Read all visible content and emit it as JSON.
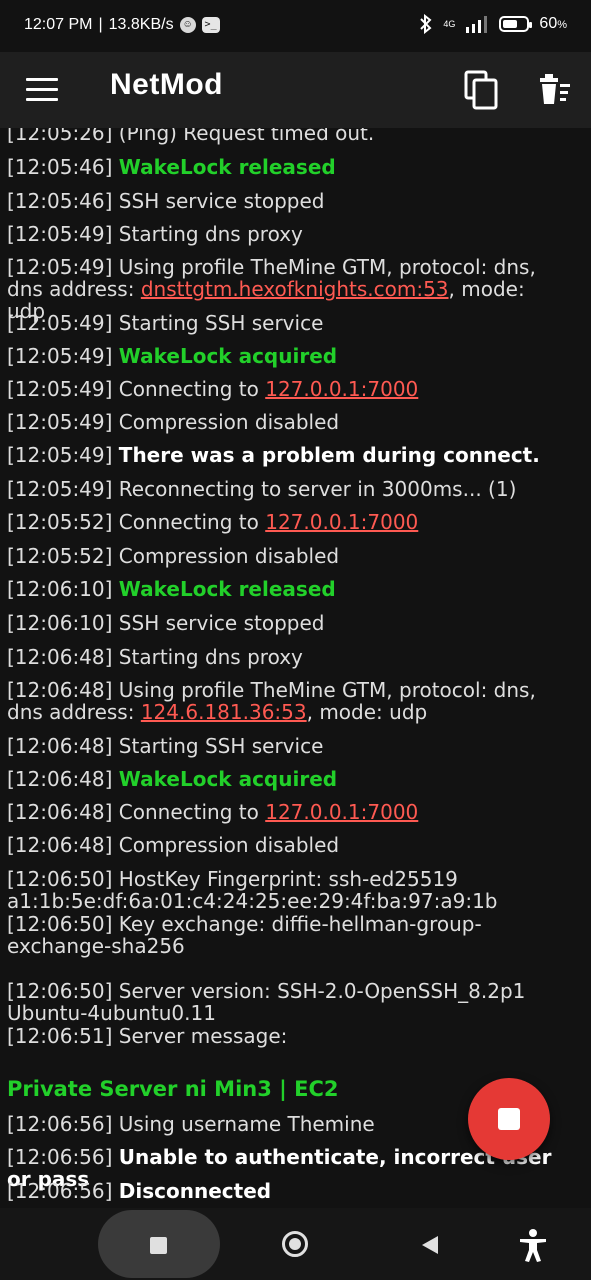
{
  "status_bar": {
    "time": "12:07 PM",
    "net_speed": "13.8KB/s",
    "network_label": "4G",
    "battery": "60",
    "battery_level": 0.6
  },
  "app": {
    "title": "NetMod"
  },
  "icons": {
    "menu": "menu-icon",
    "copy": "copy-icon",
    "clear": "clear-log-icon"
  },
  "log": [
    {
      "time": "[12:05:26]",
      "msg": "(Ping) Request timed out.",
      "style": "normal"
    },
    {
      "time": "[12:05:46]",
      "msg": "WakeLock released",
      "style": "green"
    },
    {
      "time": "[12:05:46]",
      "msg": "SSH service stopped",
      "style": "normal"
    },
    {
      "time": "[12:05:49]",
      "msg": "Starting dns proxy",
      "style": "normal"
    },
    {
      "time": "[12:05:49]",
      "msg": "Using profile TheMine GTM, protocol: dns, dns address: ",
      "link": "dnsttgtm.hexofknights.com:53",
      "suffix": ", mode: udp",
      "style": "normal"
    },
    {
      "time": "[12:05:49]",
      "msg": "Starting SSH service",
      "style": "normal"
    },
    {
      "time": "[12:05:49]",
      "msg": "WakeLock acquired",
      "style": "green"
    },
    {
      "time": "[12:05:49]",
      "msg": "Connecting to ",
      "link": "127.0.0.1:7000",
      "style": "normal"
    },
    {
      "time": "[12:05:49]",
      "msg": "Compression disabled",
      "style": "normal"
    },
    {
      "time": "[12:05:49]",
      "msg": "There was a problem during connect.",
      "style": "bold"
    },
    {
      "time": "[12:05:49]",
      "msg": "Reconnecting to server in 3000ms... (1)",
      "style": "normal"
    },
    {
      "time": "[12:05:52]",
      "msg": "Connecting to ",
      "link": "127.0.0.1:7000",
      "style": "normal"
    },
    {
      "time": "[12:05:52]",
      "msg": "Compression disabled",
      "style": "normal"
    },
    {
      "time": "[12:06:10]",
      "msg": "WakeLock released",
      "style": "green"
    },
    {
      "time": "[12:06:10]",
      "msg": "SSH service stopped",
      "style": "normal"
    },
    {
      "time": "[12:06:48]",
      "msg": "Starting dns proxy",
      "style": "normal"
    },
    {
      "time": "[12:06:48]",
      "msg": "Using profile TheMine GTM, protocol: dns, dns address: ",
      "link": "124.6.181.36:53",
      "suffix": ", mode: udp",
      "style": "normal"
    },
    {
      "time": "[12:06:48]",
      "msg": "Starting SSH service",
      "style": "normal"
    },
    {
      "time": "[12:06:48]",
      "msg": "WakeLock acquired",
      "style": "green"
    },
    {
      "time": "[12:06:48]",
      "msg": "Connecting to ",
      "link": "127.0.0.1:7000",
      "style": "normal"
    },
    {
      "time": "[12:06:48]",
      "msg": "Compression disabled",
      "style": "normal"
    },
    {
      "time": "[12:06:50]",
      "msg": "HostKey Fingerprint: ssh-ed25519 a1:1b:5e:df:6a:01:c4:24:25:ee:29:4f:ba:97:a9:1b",
      "style": "normal"
    },
    {
      "time": "[12:06:50]",
      "msg": "Key exchange: diffie-hellman-group-exchange-sha256",
      "style": "normal"
    },
    {
      "time": "[12:06:50]",
      "msg": "Server version: SSH-2.0-OpenSSH_8.2p1 Ubuntu-4ubuntu0.11",
      "style": "normal"
    },
    {
      "time": "[12:06:51]",
      "msg": "Server message:",
      "style": "normal"
    },
    {
      "time": "[12:06:56]",
      "msg": "Using username Themine",
      "style": "normal"
    },
    {
      "time": "[12:06:56]",
      "msg": "Unable to authenticate, incorrect user or pass",
      "style": "bold"
    },
    {
      "time": "[12:06:56]",
      "msg": "Disconnected",
      "style": "bold"
    }
  ],
  "server_banner": "Private Server ni Min3 | EC2",
  "fab": {
    "icon": "stop-icon"
  },
  "nav": {
    "recents": "recents-icon",
    "home": "home-icon",
    "back": "back-icon",
    "accessibility": "accessibility-icon"
  }
}
